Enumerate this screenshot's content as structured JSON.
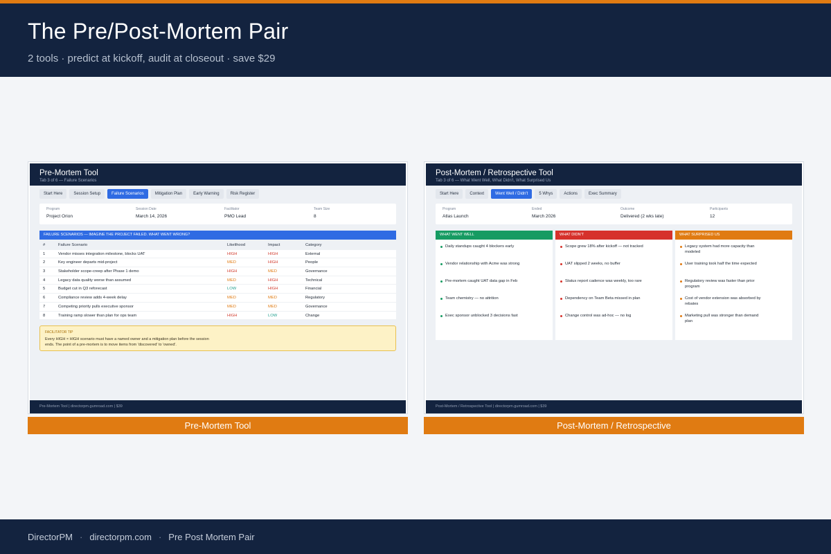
{
  "colors": {
    "navy": "#13233f",
    "accent": "#e07b12",
    "active_tab": "#2f6be3",
    "col_well": "#169b62",
    "col_didnt": "#d6312b",
    "col_surprised": "#e07b12"
  },
  "header": {
    "title": "The Pre/Post-Mortem Pair",
    "subtitle": "2 tools · predict at kickoff, audit at closeout · save $29"
  },
  "premortem": {
    "title": "Pre-Mortem Tool",
    "subtitle": "Tab 3 of 6 — Failure Scenarios",
    "tabs": [
      {
        "label": "Start Here",
        "active": false
      },
      {
        "label": "Session Setup",
        "active": false
      },
      {
        "label": "Failure Scenarios",
        "active": true
      },
      {
        "label": "Mitigation Plan",
        "active": false
      },
      {
        "label": "Early Warning",
        "active": false
      },
      {
        "label": "Risk Register",
        "active": false
      }
    ],
    "info": [
      {
        "label": "Program",
        "value": "Project Orion"
      },
      {
        "label": "Session Date",
        "value": "March 14, 2026"
      },
      {
        "label": "Facilitator",
        "value": "PMO Lead"
      },
      {
        "label": "Team Size",
        "value": "8"
      }
    ],
    "section_title": "FAILURE SCENARIOS — IMAGINE THE PROJECT FAILED. WHAT WENT WRONG?",
    "columns": [
      "#",
      "Failure Scenario",
      "Likelihood",
      "Impact",
      "Category"
    ],
    "rows": [
      {
        "num": "1",
        "scenario": "Vendor misses integration milestone, blocks UAT",
        "likelihood": "HIGH",
        "impact": "HIGH",
        "category": "External"
      },
      {
        "num": "2",
        "scenario": "Key engineer departs mid-project",
        "likelihood": "MED",
        "impact": "HIGH",
        "category": "People"
      },
      {
        "num": "3",
        "scenario": "Stakeholder scope-creep after Phase 1 demo",
        "likelihood": "HIGH",
        "impact": "MED",
        "category": "Governance"
      },
      {
        "num": "4",
        "scenario": "Legacy data quality worse than assumed",
        "likelihood": "MED",
        "impact": "HIGH",
        "category": "Technical"
      },
      {
        "num": "5",
        "scenario": "Budget cut in Q3 reforecast",
        "likelihood": "LOW",
        "impact": "HIGH",
        "category": "Financial"
      },
      {
        "num": "6",
        "scenario": "Compliance review adds 4-week delay",
        "likelihood": "MED",
        "impact": "MED",
        "category": "Regulatory"
      },
      {
        "num": "7",
        "scenario": "Competing priority pulls executive sponsor",
        "likelihood": "MED",
        "impact": "MED",
        "category": "Governance"
      },
      {
        "num": "8",
        "scenario": "Training ramp slower than plan for ops team",
        "likelihood": "HIGH",
        "impact": "LOW",
        "category": "Change"
      }
    ],
    "tip_label": "FACILITATOR TIP",
    "tip_text": "Every HIGH × HIGH scenario must have a named owner and a mitigation plan before the session ends. The point of a pre-mortem is to move items from 'discovered' to 'owned'.",
    "footer": "Pre-Mortem Tool  |  directorpm.gumroad.com  |  $39",
    "caption": "Pre-Mortem Tool"
  },
  "postmortem": {
    "title": "Post-Mortem / Retrospective Tool",
    "subtitle": "Tab 3 of 6 — What Went Well, What Didn't, What Surprised Us",
    "tabs": [
      {
        "label": "Start Here",
        "active": false
      },
      {
        "label": "Context",
        "active": false
      },
      {
        "label": "Went Well / Didn't",
        "active": true
      },
      {
        "label": "5 Whys",
        "active": false
      },
      {
        "label": "Actions",
        "active": false
      },
      {
        "label": "Exec Summary",
        "active": false
      }
    ],
    "info": [
      {
        "label": "Program",
        "value": "Atlas Launch"
      },
      {
        "label": "Ended",
        "value": "March 2026"
      },
      {
        "label": "Outcome",
        "value": "Delivered (2 wks late)"
      },
      {
        "label": "Participants",
        "value": "12"
      }
    ],
    "columns": [
      {
        "title": "WHAT WENT WELL",
        "color": "#169b62",
        "items": [
          "Daily standups caught 4 blockers early",
          "Vendor relationship with Acme was strong",
          "Pre-mortem caught UAT data gap in Feb",
          "Team chemistry — no attrition",
          "Exec sponsor unblocked 3 decisions fast"
        ]
      },
      {
        "title": "WHAT DIDN'T",
        "color": "#d6312b",
        "items": [
          "Scope grew 18% after kickoff — not tracked",
          "UAT slipped 2 weeks, no buffer",
          "Status report cadence was weekly, too rare",
          "Dependency on Team Beta missed in plan",
          "Change control was ad-hoc — no log"
        ]
      },
      {
        "title": "WHAT SURPRISED US",
        "color": "#e07b12",
        "items": [
          "Legacy system had more capacity than modeled",
          "User training took half the time expected",
          "Regulatory review was faster than prior program",
          "Cost of vendor extension was absorbed by rebates",
          "Marketing pull was stronger than demand plan"
        ]
      }
    ],
    "footer": "Post-Mortem / Retrospective Tool  |  directorpm.gumroad.com  |  $39",
    "caption": "Post-Mortem / Retrospective"
  },
  "footer": {
    "brand": "DirectorPM",
    "site": "directorpm.com",
    "page": "Pre Post Mortem Pair",
    "separator": "·"
  }
}
